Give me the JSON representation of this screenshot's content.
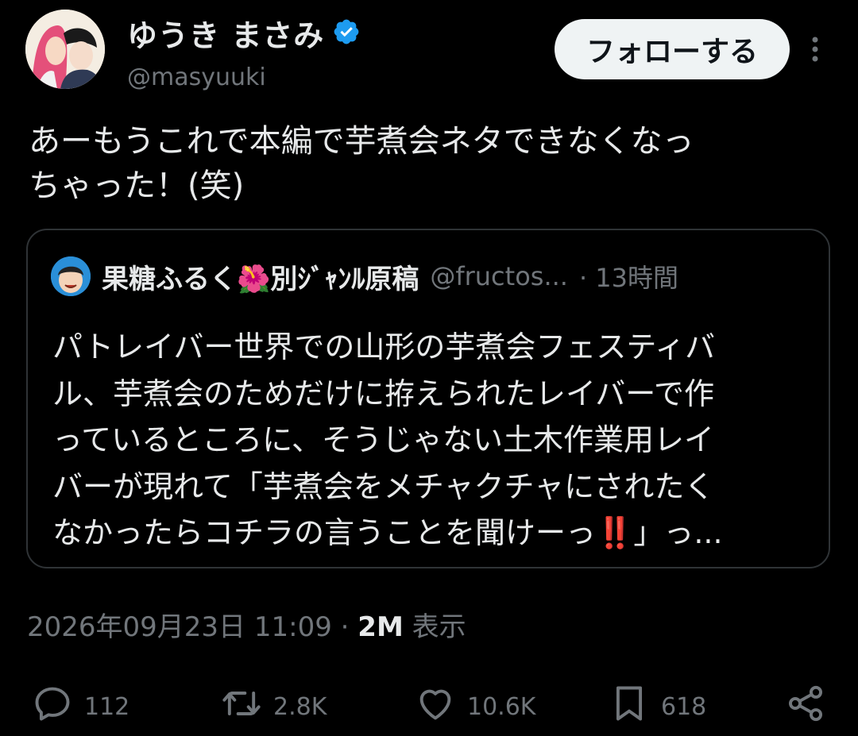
{
  "author": {
    "name": "ゆうき まさみ",
    "handle": "@masyuuki",
    "verified": true,
    "verified_color": "#1d9bf0",
    "follow_label": "フォローする",
    "more_icon": "more-vertical-icon"
  },
  "tweet": {
    "text_line1": "あーもうこれで本編で芋煮会ネタできなくなっ",
    "text_line2": "ちゃった！(笑)"
  },
  "quote": {
    "name": "果糖ふるく🌺別ｼﾞｬﾝﾙ原稿",
    "handle": "@fructos...",
    "time": "· 13時間",
    "lines": [
      "パトレイバー世界での山形の芋煮会フェスティバ",
      "ル、芋煮会のためだけに拵えられたレイバーで作",
      "っているところに、そうじゃない土木作業用レイ",
      "バーが現れて「芋煮会をメチャクチャにされたく"
    ],
    "last_line_start": "なかったらコチラの言うことを聞けーっ",
    "last_line_emoji": "‼️",
    "last_line_end": "」っ..."
  },
  "meta": {
    "datetime": "2026年09月23日 11:09",
    "separator": "·",
    "views_count": "2M",
    "views_label": "表示"
  },
  "actions": {
    "reply": {
      "icon": "reply-icon",
      "count": "112"
    },
    "retweet": {
      "icon": "retweet-icon",
      "count": "2.8K"
    },
    "like": {
      "icon": "heart-icon",
      "count": "10.6K"
    },
    "bookmark": {
      "icon": "bookmark-icon",
      "count": "618"
    },
    "share": {
      "icon": "share-icon"
    }
  },
  "colors": {
    "background": "#000000",
    "text": "#e7e9ea",
    "secondary": "#71767b",
    "border": "#2f3336"
  }
}
